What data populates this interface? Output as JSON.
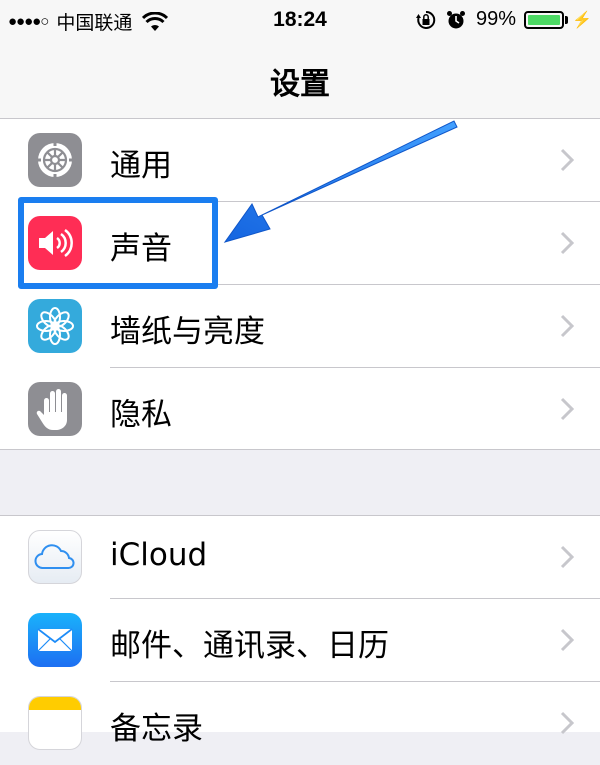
{
  "status_bar": {
    "signal": "●●●●○",
    "carrier": "中国联通",
    "time": "18:24",
    "battery_percent": "99%",
    "battery_level": 0.99,
    "icons": [
      "wifi-icon",
      "rotation-lock-icon",
      "alarm-icon",
      "battery-icon",
      "charging-icon"
    ]
  },
  "nav": {
    "title": "设置"
  },
  "groups": [
    {
      "items": [
        {
          "label": "通用",
          "icon": "gear-icon",
          "icon_color": "#8e8e93"
        },
        {
          "label": "声音",
          "icon": "speaker-icon",
          "icon_color": "#ff2d55"
        },
        {
          "label": "墙纸与亮度",
          "icon": "flower-icon",
          "icon_color": "#34aadc"
        },
        {
          "label": "隐私",
          "icon": "hand-icon",
          "icon_color": "#8e8e93"
        }
      ]
    },
    {
      "items": [
        {
          "label": "iCloud",
          "icon": "cloud-icon",
          "icon_color": "#ffffff"
        },
        {
          "label": "邮件、通讯录、日历",
          "icon": "envelope-icon",
          "icon_color": "#1d8cf8"
        },
        {
          "label": "备忘录",
          "icon": "notes-icon",
          "icon_color": "#ffcc00"
        }
      ]
    }
  ],
  "annotation": {
    "highlight_color": "#1a7ef0",
    "target": "声音"
  }
}
